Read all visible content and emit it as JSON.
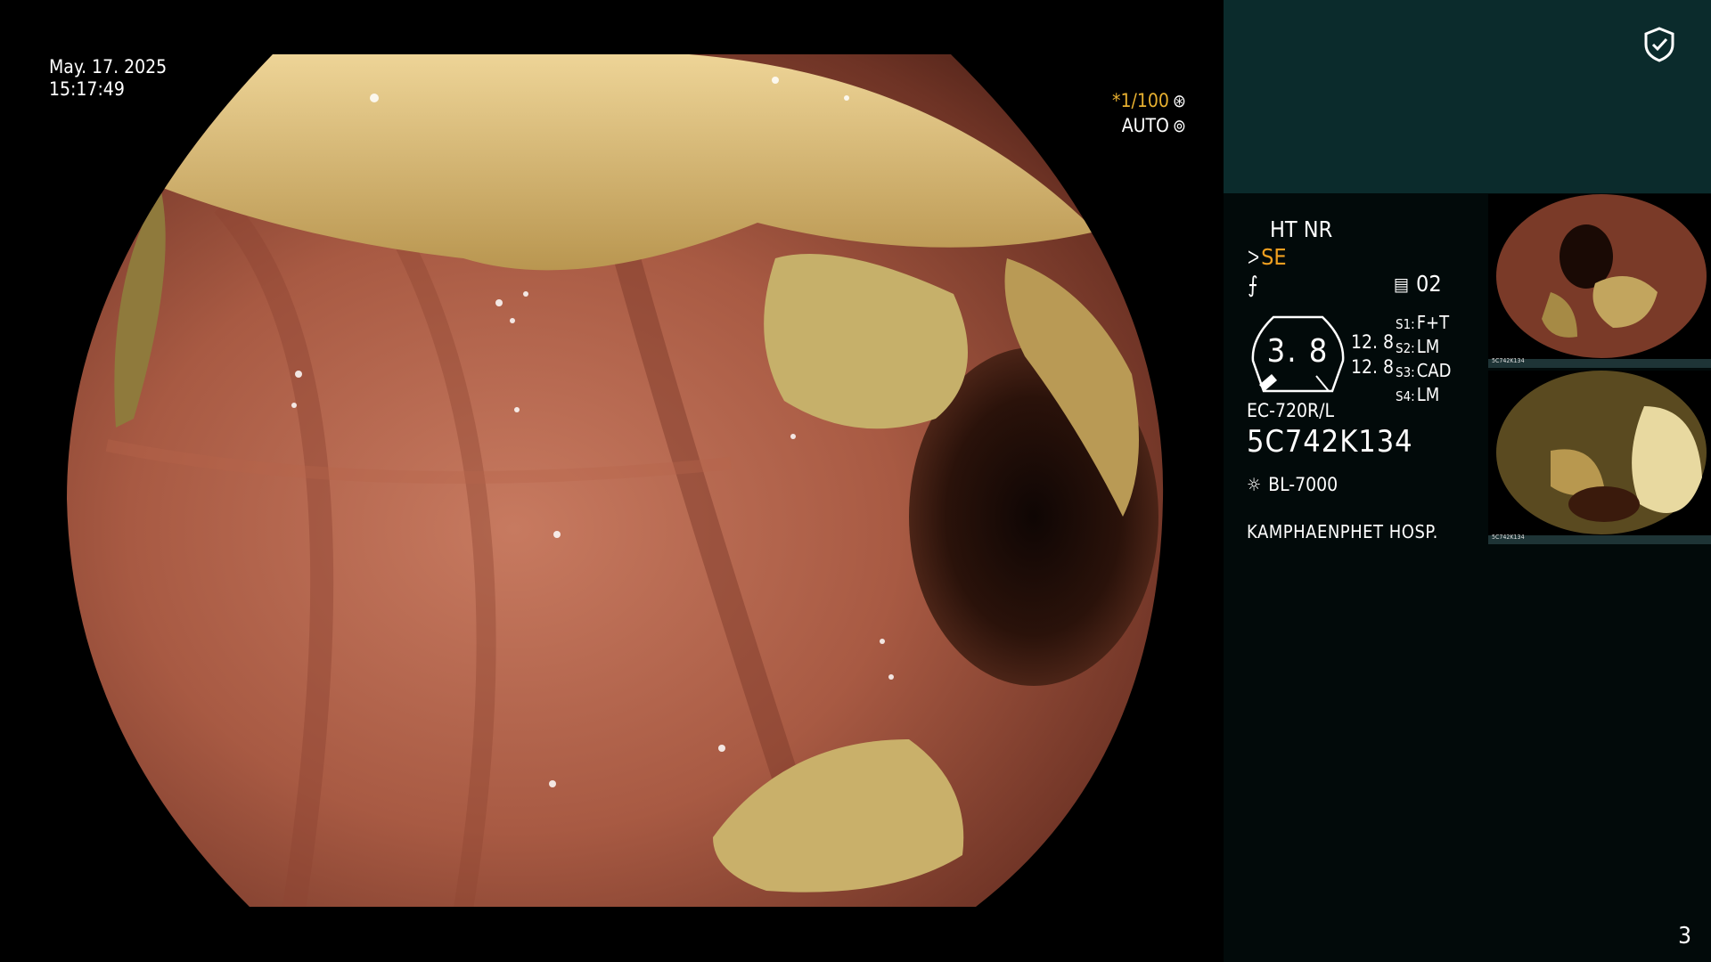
{
  "overlay": {
    "date": "May. 17. 2025",
    "time": "15:17:49",
    "shutter_value": "*1/100",
    "shutter_icon": "aperture-icon",
    "iris_mode": "AUTO",
    "iris_icon": "iris-icon"
  },
  "panel": {
    "header_color": "#0b2b2c",
    "shield_icon": "shield-check-icon",
    "enhancement": "HT NR",
    "structure_value": "SE",
    "structure_icon": "structure-icon",
    "color_icon": "color-curve-icon",
    "memory_icon": "memory-icon",
    "memory_count": "02",
    "gauge_value": "3. 8",
    "zoom_values": [
      "12. 8",
      "12. 8"
    ],
    "switches": [
      {
        "key": "S1:",
        "value": "F+T"
      },
      {
        "key": "S2:",
        "value": "LM"
      },
      {
        "key": "S3:",
        "value": "CAD"
      },
      {
        "key": "S4:",
        "value": "LM"
      }
    ],
    "scope_model": "EC-720R/L",
    "scope_serial": "5C742K134",
    "light_icon": "light-source-icon",
    "light_source": "BL-7000",
    "hospital": "KAMPHAENPHET HOSP."
  },
  "thumbnails": [
    {
      "caption": "5C742K134",
      "index": "2"
    },
    {
      "caption": "5C742K134",
      "index": "1"
    }
  ],
  "page_number": "3"
}
